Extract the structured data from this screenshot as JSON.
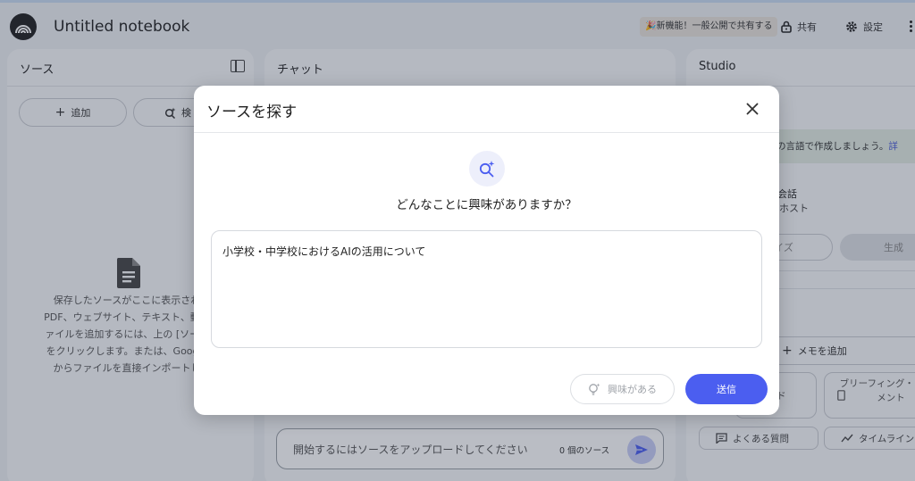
{
  "header": {
    "title": "Untitled notebook",
    "new_feature": "🎉新機能！一般公開で共有する",
    "share_label": "共有",
    "settings_label": "設定"
  },
  "sources": {
    "title": "ソース",
    "add_label": "追加",
    "search_label": "検",
    "empty_lines": [
      "保存したソースがここに表示され",
      "PDF、ウェブサイト、テキスト、動画",
      "ァイルを追加するには、上の [ソース",
      "をクリックします。または、Google",
      "からファイルを直接インポートし"
    ]
  },
  "chat": {
    "title": "チャット",
    "input_placeholder": "開始するにはソースをアップロードしてください",
    "source_count": "0 個のソース"
  },
  "studio": {
    "title": "Studio",
    "banner_text": "多くの言語で作成しましょう。",
    "banner_link": "詳",
    "audio_line1": "会話",
    "audio_line2": "ホスト",
    "customize_label": "イズ",
    "generate_label": "生成",
    "add_memo_label": "メモを追加",
    "tile1_label": "ド",
    "tile2_label": "ブリーフィング・ドキュメント",
    "faq_label": "よくある質問",
    "timeline_label": "タイムライン"
  },
  "modal": {
    "title": "ソースを探す",
    "question": "どんなことに興味がありますか？",
    "query_value": "小学校・中学校におけるAIの活用について",
    "interest_label": "興味がある",
    "submit_label": "送信"
  }
}
